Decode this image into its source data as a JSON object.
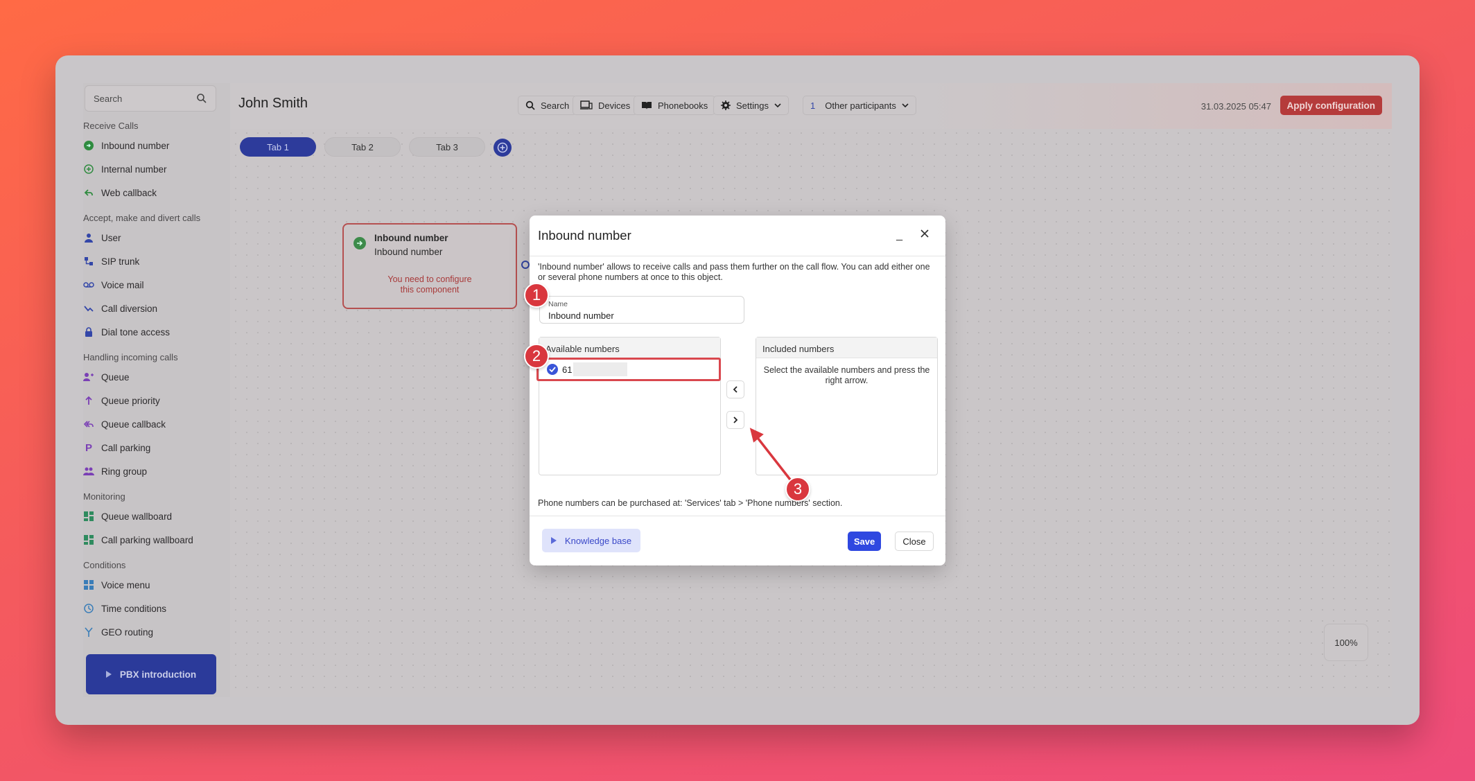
{
  "sidebar": {
    "search_placeholder": "Search",
    "sections": {
      "receive": "Receive Calls",
      "accept": "Accept, make and divert calls",
      "handling": "Handling incoming calls",
      "monitoring": "Monitoring",
      "conditions": "Conditions"
    },
    "items": {
      "inbound": "Inbound number",
      "internal": "Internal number",
      "webcallback": "Web callback",
      "user": "User",
      "siptrunk": "SIP trunk",
      "voicemail": "Voice mail",
      "calldiversion": "Call diversion",
      "dialtone": "Dial tone access",
      "queue": "Queue",
      "queuepriority": "Queue priority",
      "queuecallback": "Queue callback",
      "callparking": "Call parking",
      "ringgroup": "Ring group",
      "queuewallboard": "Queue wallboard",
      "callparkingwallboard": "Call parking wallboard",
      "voicemenu": "Voice menu",
      "timeconditions": "Time conditions",
      "georouting": "GEO routing"
    },
    "pbx_intro": "PBX introduction"
  },
  "topbar": {
    "user_name": "John Smith",
    "search": "Search",
    "devices": "Devices",
    "phonebooks": "Phonebooks",
    "settings": "Settings",
    "participants_count": "1",
    "participants": "Other participants",
    "datetime": "31.03.2025 05:47",
    "apply": "Apply configuration"
  },
  "tabs": [
    "Tab 1",
    "Tab 2",
    "Tab 3"
  ],
  "canvas": {
    "node_title": "Inbound number",
    "node_subtitle": "Inbound number",
    "node_warning": "You need to configure this component",
    "zoom": "100%"
  },
  "modal": {
    "title": "Inbound number",
    "minimize": "_",
    "description": "'Inbound number' allows to receive calls and pass them further on the call flow. You can add either one or several phone numbers at once to this object.",
    "name_label": "Name",
    "name_value": "Inbound number",
    "available_header": "Available numbers",
    "available_number": "61",
    "included_header": "Included numbers",
    "included_empty": "Select the available numbers and press the right arrow.",
    "note": "Phone numbers can be purchased at: 'Services' tab > 'Phone numbers' section.",
    "knowledge_base": "Knowledge base",
    "save": "Save",
    "close": "Close"
  },
  "annotations": [
    "1",
    "2",
    "3"
  ],
  "colors": {
    "accent": "#2f48e0",
    "apply": "#b53b3b",
    "badge": "#d9373e"
  }
}
